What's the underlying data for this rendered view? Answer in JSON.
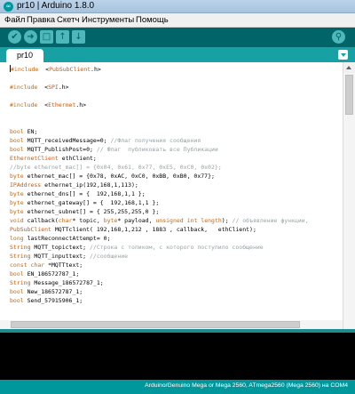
{
  "window": {
    "title": "pr10 | Arduino 1.8.0",
    "app_icon": "∞"
  },
  "menu": [
    "Файл",
    "Правка",
    "Скетч",
    "Инструменты",
    "Помощь"
  ],
  "toolbar": {
    "buttons": [
      {
        "name": "verify-icon",
        "glyph": "✔"
      },
      {
        "name": "upload-icon",
        "glyph": "➜"
      },
      {
        "name": "new-icon",
        "glyph": "□"
      },
      {
        "name": "open-icon",
        "glyph": "↑"
      },
      {
        "name": "save-icon",
        "glyph": "↓"
      }
    ],
    "serial_monitor_glyph": "⚲"
  },
  "tabs": [
    {
      "label": "pr10"
    }
  ],
  "colors": {
    "teal_dark": "#006468",
    "teal": "#00979c",
    "teal_light": "#17a1a5",
    "keyword": "#cc6600",
    "type": "#d35400",
    "comment": "#95a5a6"
  },
  "code_lines": [
    [
      [
        "kw",
        "#include"
      ],
      [
        "",
        "  <"
      ],
      [
        "ty",
        "PubSubClient"
      ],
      [
        "",
        ".h>"
      ]
    ],
    [],
    [
      [
        "kw",
        "#include"
      ],
      [
        "",
        "  <"
      ],
      [
        "ty",
        "SPI"
      ],
      [
        "",
        ".h>"
      ]
    ],
    [],
    [
      [
        "kw",
        "#include"
      ],
      [
        "",
        "  <"
      ],
      [
        "ty",
        "Ethernet"
      ],
      [
        "",
        ".h>"
      ]
    ],
    [],
    [],
    [
      [
        "kw",
        "bool"
      ],
      [
        "",
        " EN;"
      ]
    ],
    [
      [
        "kw",
        "bool"
      ],
      [
        "",
        " MQTT_receivedMessage=0; "
      ],
      [
        "cmt",
        "//Флаг получения сообщения"
      ]
    ],
    [
      [
        "kw",
        "bool"
      ],
      [
        "",
        " MQTT_PublishPost=0; "
      ],
      [
        "cmt",
        "// Флаг  публиковать все Публикации"
      ]
    ],
    [
      [
        "ty",
        "EthernetClient"
      ],
      [
        "",
        " ethClient;"
      ]
    ],
    [
      [
        "cmt",
        "//byte ethernet_mac[] = {0x04, 0x61, 0x77, 0xE5, 0xC0, 0x02};"
      ]
    ],
    [
      [
        "kw",
        "byte"
      ],
      [
        "",
        " ethernet_mac[] = {0x78, 0xAC, 0xC0, 0xBB, 0xB0, 0x77};"
      ]
    ],
    [
      [
        "ty",
        "IPAddress"
      ],
      [
        "",
        " ethernet_ip(192,168,1,113);"
      ]
    ],
    [
      [
        "kw",
        "byte"
      ],
      [
        "",
        " ethernet_dns[] = {  192,168,1,1 };"
      ]
    ],
    [
      [
        "kw",
        "byte"
      ],
      [
        "",
        " ethernet_gateway[] = {  192,168,1,1 };"
      ]
    ],
    [
      [
        "kw",
        "byte"
      ],
      [
        "",
        " ethernet_subnet[] = { 255,255,255,0 };"
      ]
    ],
    [
      [
        "kw",
        "void"
      ],
      [
        "",
        " callback("
      ],
      [
        "kw",
        "char"
      ],
      [
        "",
        "* topic, "
      ],
      [
        "kw",
        "byte"
      ],
      [
        "",
        "* payload, "
      ],
      [
        "kw",
        "unsigned"
      ],
      [
        "",
        " "
      ],
      [
        "kw",
        "int"
      ],
      [
        "",
        " "
      ],
      [
        "kw",
        "length"
      ],
      [
        "",
        "); "
      ],
      [
        "cmt",
        "// объявление функции,"
      ]
    ],
    [
      [
        "ty",
        "PubSubClient"
      ],
      [
        "",
        " MQTTclient( 192,168,1,212 , 1883 , callback,   ethClient);"
      ]
    ],
    [
      [
        "kw",
        "long"
      ],
      [
        "",
        " lastReconnectAttempt= 0;"
      ]
    ],
    [
      [
        "ty",
        "String"
      ],
      [
        "",
        " MQTT_topictext; "
      ],
      [
        "cmt",
        "//Строка с топиком, с которого поступило сообщение"
      ]
    ],
    [
      [
        "ty",
        "String"
      ],
      [
        "",
        " MQTT_inputtext; "
      ],
      [
        "cmt",
        "//сообщение"
      ]
    ],
    [
      [
        "kw",
        "const"
      ],
      [
        "",
        " "
      ],
      [
        "kw",
        "char"
      ],
      [
        "",
        " *MQTTtext;"
      ]
    ],
    [
      [
        "kw",
        "bool"
      ],
      [
        "",
        " EN_186572787_1;"
      ]
    ],
    [
      [
        "ty",
        "String"
      ],
      [
        "",
        " Message_186572787_1;"
      ]
    ],
    [
      [
        "kw",
        "bool"
      ],
      [
        "",
        " New_186572787_1;"
      ]
    ],
    [
      [
        "kw",
        "bool"
      ],
      [
        "",
        " Send_57915906_1;"
      ]
    ]
  ],
  "status": {
    "board": "Arduino/Genuino Mega or Mega 2560, ATmega2560 (Mega 2560) на COM4"
  }
}
